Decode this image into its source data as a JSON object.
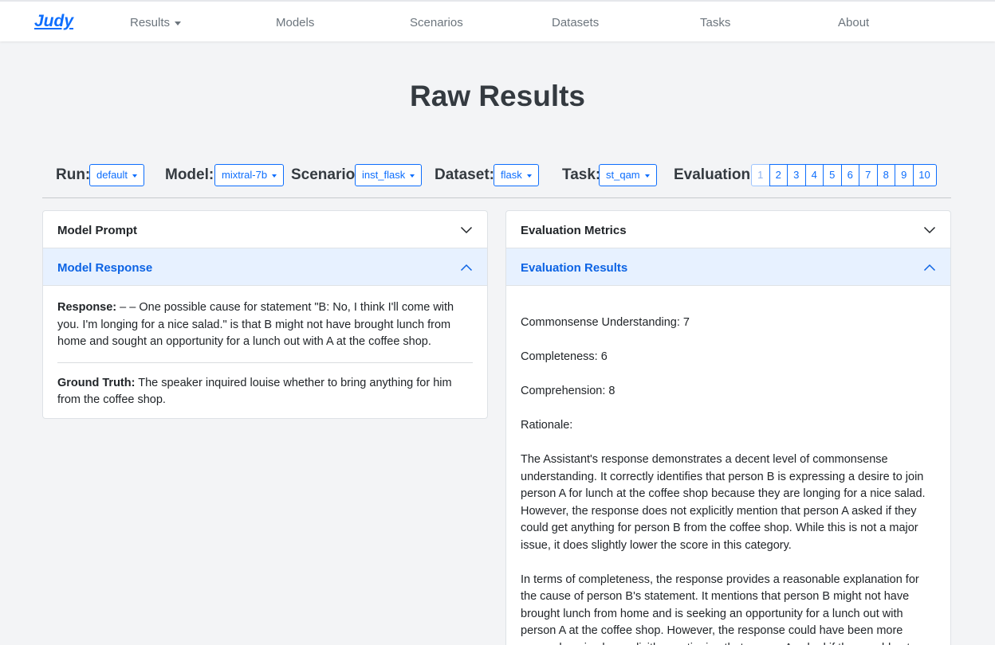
{
  "nav": {
    "brand": "Judy",
    "items": [
      "Results",
      "Models",
      "Scenarios",
      "Datasets",
      "Tasks",
      "About"
    ]
  },
  "page": {
    "title": "Raw Results"
  },
  "filters": {
    "run_label": "Run:",
    "run_value": "default",
    "model_label": "Model:",
    "model_value": "mixtral-7b",
    "scenario_label": "Scenario:",
    "scenario_value": "inst_flask",
    "dataset_label": "Dataset:",
    "dataset_value": "flask",
    "task_label": "Task:",
    "task_value": "st_qam",
    "evaluation_label": "Evaluation:",
    "pages": [
      "1",
      "2",
      "3",
      "4",
      "5",
      "6",
      "7",
      "8",
      "9",
      "10"
    ],
    "active_page": "1"
  },
  "left_panel": {
    "prompt_title": "Model Prompt",
    "response_title": "Model Response",
    "response_label": "Response:",
    "response_text": " – – One possible cause for statement \"B: No, I think I'll come with you. I'm longing for a nice salad.\" is that B might not have brought lunch from home and sought an opportunity for a lunch out with A at the coffee shop.",
    "truth_label": "Ground Truth:",
    "truth_text": " The speaker inquired louise whether to bring anything for him from the coffee shop."
  },
  "right_panel": {
    "metrics_title": "Evaluation Metrics",
    "results_title": "Evaluation Results",
    "metric_1": "Commonsense Understanding: 7",
    "metric_2": "Completeness: 6",
    "metric_3": "Comprehension: 8",
    "rationale_label": "Rationale:",
    "paragraph_1": "The Assistant's response demonstrates a decent level of commonsense understanding. It correctly identifies that person B is expressing a desire to join person A for lunch at the coffee shop because they are longing for a nice salad. However, the response does not explicitly mention that person A asked if they could get anything for person B from the coffee shop. While this is not a major issue, it does slightly lower the score in this category.",
    "paragraph_2": "In terms of completeness, the response provides a reasonable explanation for the cause of person B's statement. It mentions that person B might not have brought lunch from home and is seeking an opportunity for a lunch out with person A at the coffee shop. However, the response could have been more comprehensive by explicitly mentioning that person A asked if they could get anything for person B from the coffee shop."
  }
}
